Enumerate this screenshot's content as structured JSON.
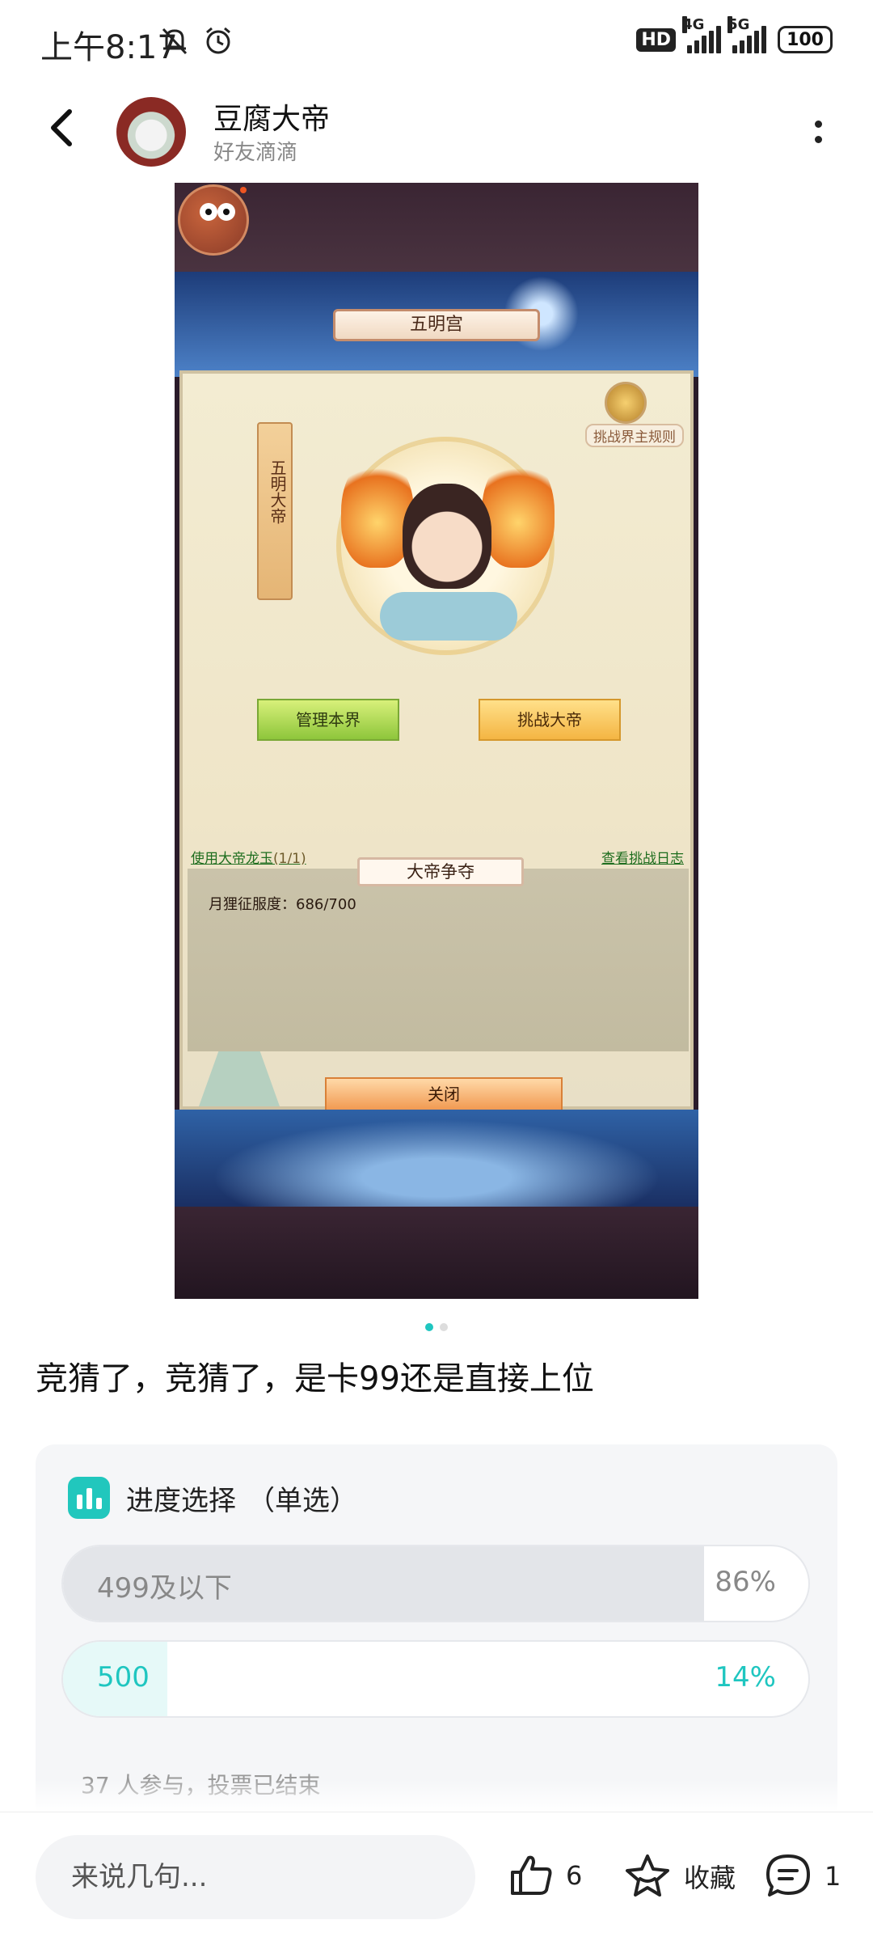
{
  "status_bar": {
    "time": "上午8:17",
    "hd": "HD",
    "net1": "4G",
    "net2": "5G",
    "battery": "100"
  },
  "header": {
    "username": "豆腐大帝",
    "subtitle": "好友滴滴"
  },
  "game": {
    "palace_title": "五明宫",
    "scroll_text": "五明大帝",
    "rules_label": "挑战界主规则",
    "manage_button": "管理本界",
    "challenge_button": "挑战大帝",
    "use_jade_link": "使用大帝龙玉",
    "use_jade_count": "(1/1)",
    "log_link": "查看挑战日志",
    "contest_title": "大帝争夺",
    "conquest_text": "月狸征服度：686/700",
    "close_button": "关闭"
  },
  "carousel": {
    "count": 2,
    "active": 0
  },
  "post": {
    "text": "竞猜了，竞猜了，是卡99还是直接上位"
  },
  "poll": {
    "title": "进度选择",
    "type": "（单选）",
    "options": [
      {
        "label": "499及以下",
        "percent": "86%",
        "fraction": 0.86,
        "fill_color": "#e3e5e9",
        "text_color": "#888888"
      },
      {
        "label": "500",
        "percent": "14%",
        "fraction": 0.14,
        "fill_color": "#e6f9f8",
        "text_color": "#1fc6c0"
      }
    ],
    "footer": "37 人参与，投票已结束",
    "accent": "#21c7bd"
  },
  "bottom_bar": {
    "comment_placeholder": "来说几句...",
    "like_count": "6",
    "favorite_label": "收藏",
    "comment_count": "1"
  }
}
